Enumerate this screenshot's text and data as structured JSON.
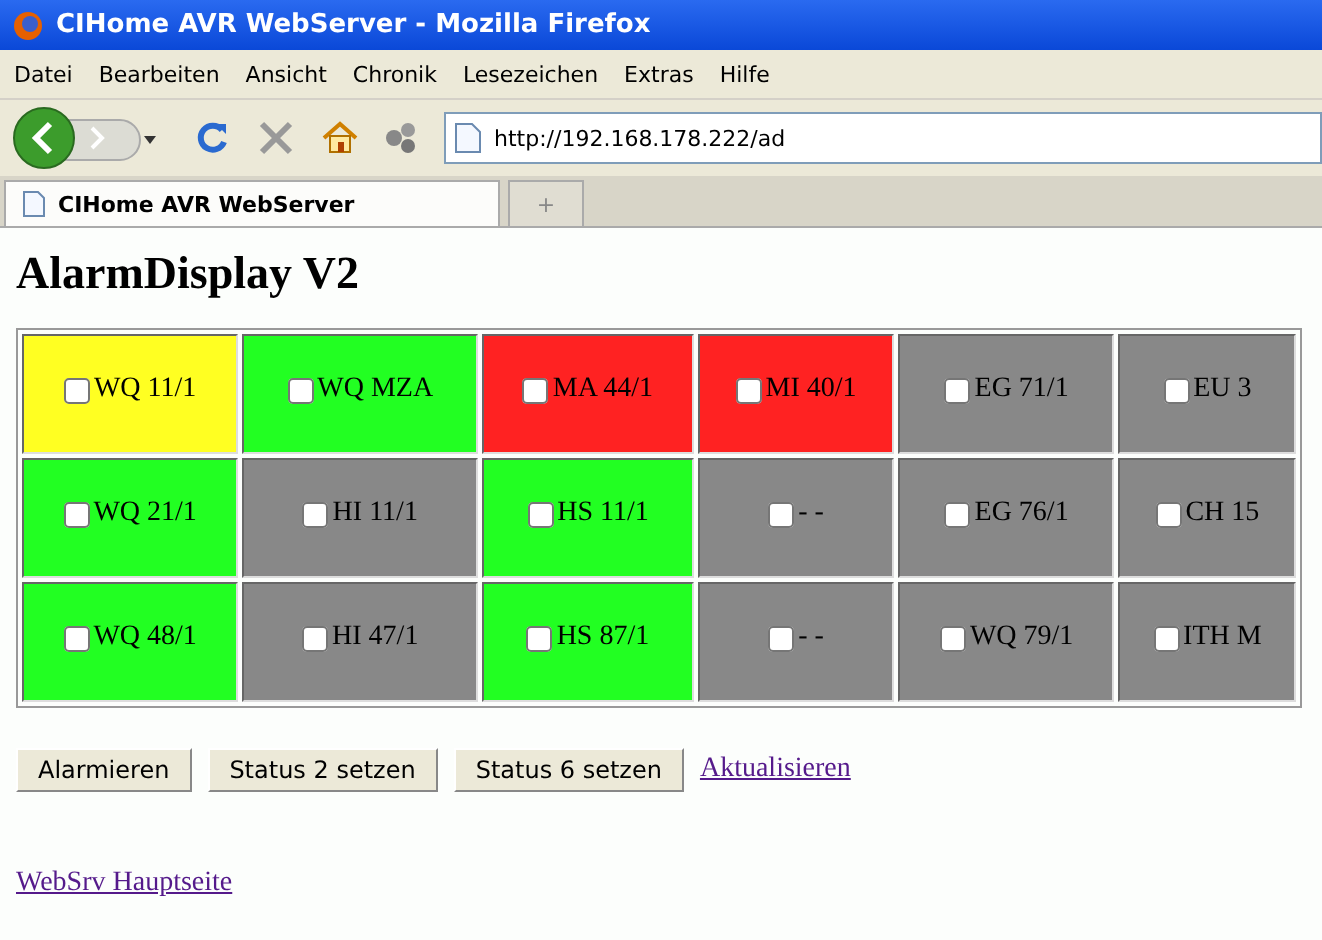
{
  "window": {
    "title": "CIHome AVR WebServer - Mozilla Firefox"
  },
  "menu": [
    "Datei",
    "Bearbeiten",
    "Ansicht",
    "Chronik",
    "Lesezeichen",
    "Extras",
    "Hilfe"
  ],
  "address": {
    "value": "http://192.168.178.222/ad"
  },
  "tabs": [
    {
      "label": "CIHome AVR WebServer",
      "selected": true
    },
    {
      "label": "+",
      "selected": false
    }
  ],
  "heading": "AlarmDisplay V2",
  "grid": [
    [
      {
        "label": "WQ 11/1",
        "color": "#ffff22",
        "checked": false
      },
      {
        "label": "WQ MZA",
        "color": "#22ff22",
        "checked": false
      },
      {
        "label": "MA 44/1",
        "color": "#ff2222",
        "checked": false
      },
      {
        "label": "MI 40/1",
        "color": "#ff2222",
        "checked": false
      },
      {
        "label": "EG 71/1",
        "color": "#888888",
        "checked": false
      },
      {
        "label": "EU 3",
        "color": "#888888",
        "checked": false
      }
    ],
    [
      {
        "label": "WQ 21/1",
        "color": "#22ff22",
        "checked": false
      },
      {
        "label": "HI 11/1",
        "color": "#888888",
        "checked": false
      },
      {
        "label": "HS 11/1",
        "color": "#22ff22",
        "checked": false
      },
      {
        "label": "- -",
        "color": "#888888",
        "checked": false
      },
      {
        "label": "EG 76/1",
        "color": "#888888",
        "checked": false
      },
      {
        "label": "CH 15",
        "color": "#888888",
        "checked": false
      }
    ],
    [
      {
        "label": "WQ 48/1",
        "color": "#22ff22",
        "checked": false
      },
      {
        "label": "HI 47/1",
        "color": "#888888",
        "checked": false
      },
      {
        "label": "HS 87/1",
        "color": "#22ff22",
        "checked": false
      },
      {
        "label": "- -",
        "color": "#888888",
        "checked": false
      },
      {
        "label": "WQ 79/1",
        "color": "#888888",
        "checked": false
      },
      {
        "label": "ITH M",
        "color": "#888888",
        "checked": false
      }
    ]
  ],
  "buttons": [
    "Alarmieren",
    "Status 2 setzen",
    "Status 6 setzen"
  ],
  "refresh_link": "Aktualisieren",
  "home_link": "WebSrv Hauptseite"
}
